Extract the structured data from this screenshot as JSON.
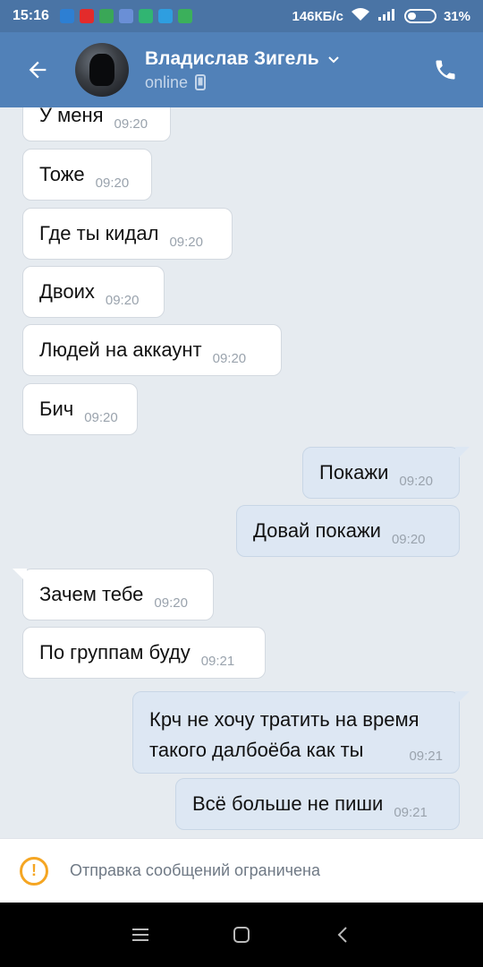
{
  "status_bar": {
    "time": "15:16",
    "network_speed": "146КБ/с",
    "battery_percent": "31%",
    "battery_level": 0.31
  },
  "header": {
    "contact_name": "Владислав Зигель",
    "status": "online",
    "icons": [
      "back-arrow-icon",
      "chevron-down-icon",
      "phone-device-icon",
      "phone-call-icon"
    ]
  },
  "messages": [
    {
      "dir": "in",
      "text": "У меня",
      "time": "09:20"
    },
    {
      "dir": "in",
      "text": "Тоже",
      "time": "09:20"
    },
    {
      "dir": "in",
      "text": "Где ты кидал",
      "time": "09:20"
    },
    {
      "dir": "in",
      "text": "Двоих",
      "time": "09:20"
    },
    {
      "dir": "in",
      "text": "Людей на аккаунт",
      "time": "09:20"
    },
    {
      "dir": "in",
      "text": "Бич",
      "time": "09:20"
    },
    {
      "dir": "out",
      "text": "Покажи",
      "time": "09:20"
    },
    {
      "dir": "out",
      "text": "Довай покажи",
      "time": "09:20"
    },
    {
      "dir": "in",
      "text": "Зачем тебе",
      "time": "09:20"
    },
    {
      "dir": "in",
      "text": "По группам буду",
      "time": "09:21"
    },
    {
      "dir": "out",
      "text": "Крч не хочу тратить на время такого далбоёба как ты",
      "line1": "Крч не хочу тратить на время",
      "line2": "такого далбоёба как ты",
      "time": "09:21"
    },
    {
      "dir": "out",
      "text": "Всё больше не пиши",
      "time": "09:21"
    }
  ],
  "restriction": {
    "text": "Отправка сообщений ограничена"
  },
  "colors": {
    "header": "#5181b8",
    "status_bar": "#4a74a5",
    "chat_bg": "#e6ebf0",
    "incoming_bubble": "#ffffff",
    "outgoing_bubble": "#dde7f3",
    "warning": "#f5a623"
  }
}
